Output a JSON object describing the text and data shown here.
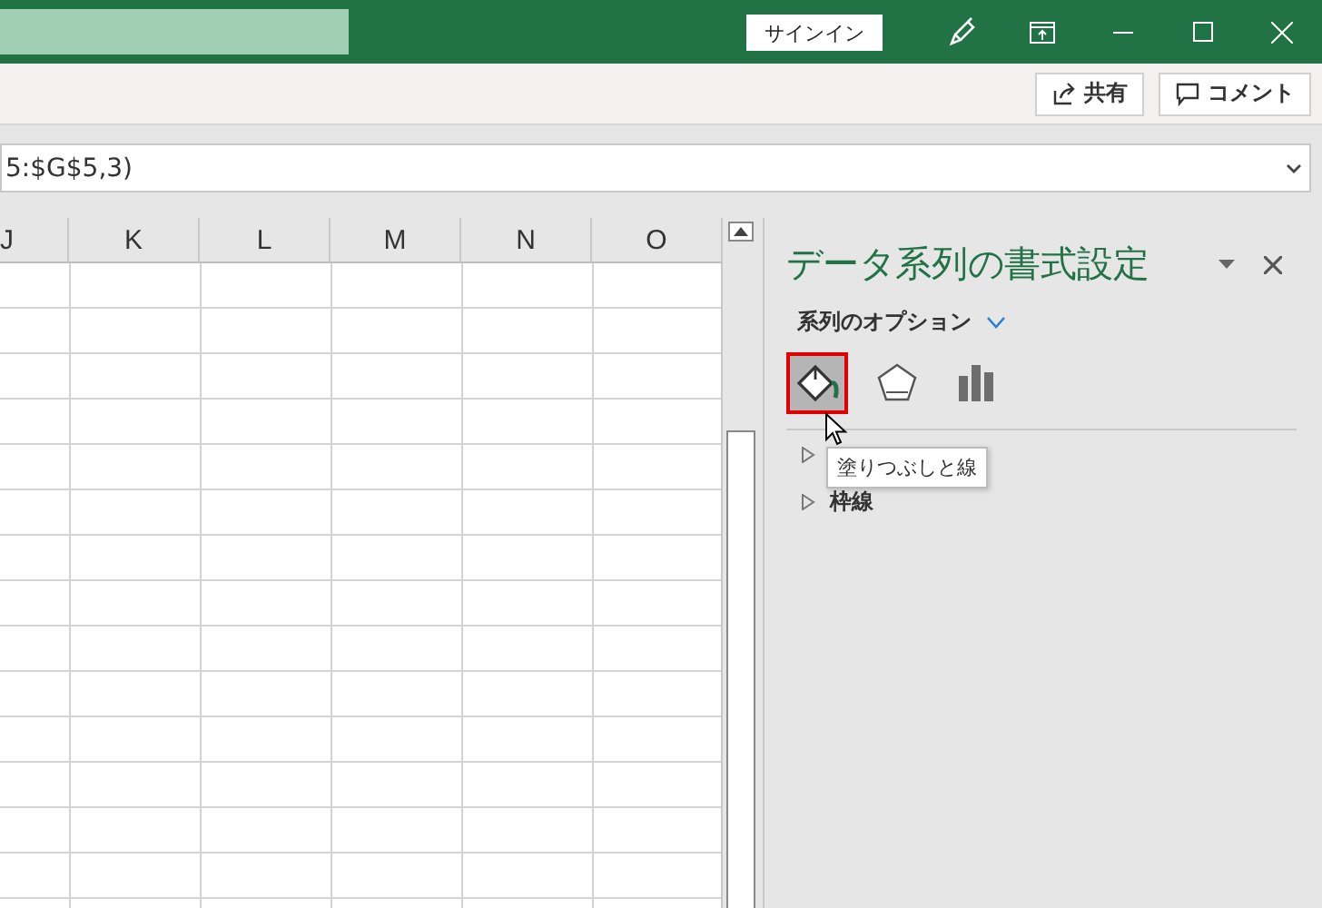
{
  "title_bar": {
    "sign_in": "サインイン"
  },
  "ribbon": {
    "buttons": [
      {
        "kind": "share",
        "label": "共有"
      },
      {
        "kind": "comment",
        "label": "コメント"
      }
    ]
  },
  "formula_bar": {
    "value": "5:$G$5,3)"
  },
  "sheet": {
    "columns": [
      "J",
      "K",
      "L",
      "M",
      "N",
      "O"
    ]
  },
  "pane": {
    "title": "データ系列の書式設定",
    "subtitle": "系列のオプション",
    "tabs": [
      {
        "kind": "fill",
        "selected": true
      },
      {
        "kind": "effects",
        "selected": false
      },
      {
        "kind": "options",
        "selected": false
      }
    ],
    "tooltip": "塗りつぶしと線",
    "sections": [
      {
        "expanded": false
      },
      {
        "label": "枠線",
        "expanded": false
      }
    ]
  }
}
